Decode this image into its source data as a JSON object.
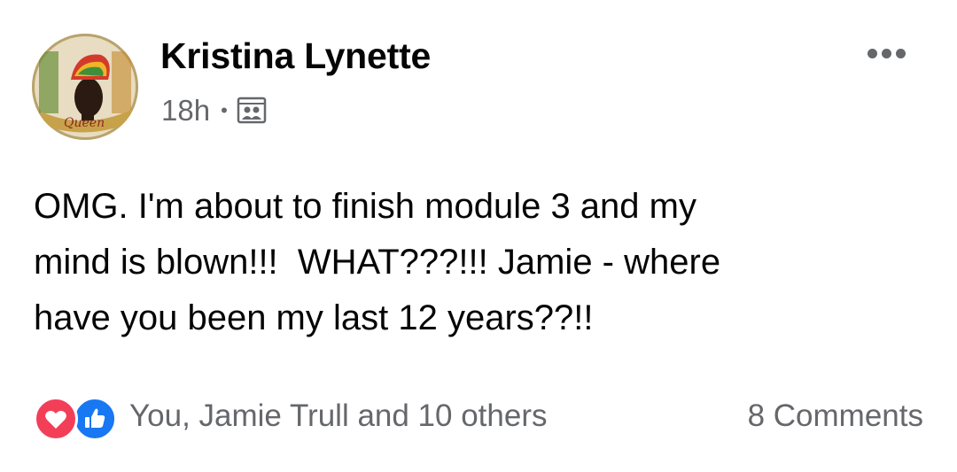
{
  "post": {
    "author_name": "Kristina Lynette",
    "timestamp": "18h",
    "separator": "•",
    "audience_icon": "group-audience-icon",
    "avatar_text": "Queen",
    "more_icon": "more-options-icon",
    "body": "OMG. I'm about to finish module 3 and my\nmind is blown!!!  WHAT???!!! Jamie - where\nhave you been my last 12 years??!!",
    "reactions": {
      "icons": [
        "love-icon",
        "like-icon"
      ],
      "summary": "You, Jamie Trull and 10 others"
    },
    "comments_count": "8 Comments"
  },
  "colors": {
    "text_primary": "#050505",
    "text_secondary": "#65676b",
    "love": "#f33e58",
    "like": "#1877f2"
  }
}
